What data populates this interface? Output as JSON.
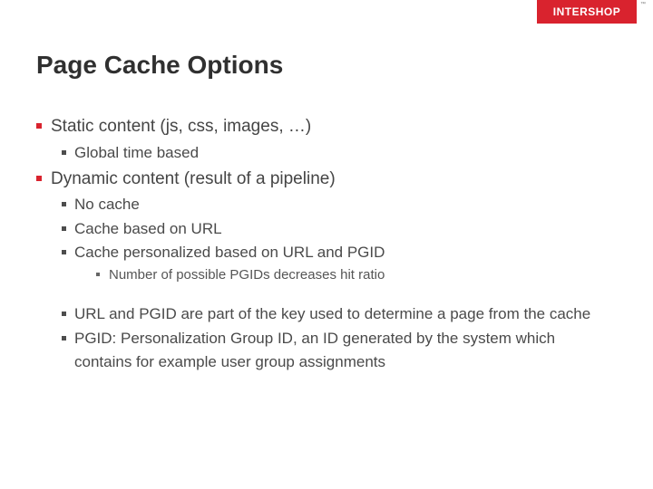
{
  "brand": {
    "name": "INTERSHOP",
    "tm": "™"
  },
  "title": "Page Cache Options",
  "bullets": {
    "b1": "Static content (js, css, images, …)",
    "b1_1": "Global time based",
    "b2": "Dynamic content (result of a pipeline)",
    "b2_1": "No cache",
    "b2_2": "Cache based on URL",
    "b2_3": "Cache personalized based on URL and PGID",
    "b2_3_1": "Number of possible PGIDs decreases hit ratio",
    "b2_4": "URL and PGID are part of the key used to determine a page from the cache",
    "b2_5": "PGID: Personalization Group ID, an ID generated by the system which contains for example user group assignments"
  }
}
